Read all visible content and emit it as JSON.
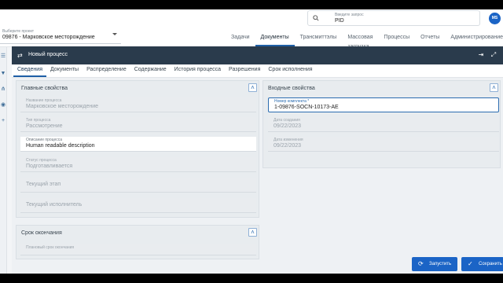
{
  "header": {
    "project_select": {
      "label": "Выберите проект",
      "value": "09876 - Марковское месторождение"
    },
    "search": {
      "label": "Введите запрос",
      "value": "PID"
    },
    "avatar": "MS"
  },
  "nav_tabs": [
    {
      "label": "Задачи"
    },
    {
      "label": "Документы"
    },
    {
      "label": "Трансмиттэлы"
    },
    {
      "label": "Массовая загрузка"
    },
    {
      "label": "Процессы"
    },
    {
      "label": "Отчеты"
    },
    {
      "label": "Администрирование"
    }
  ],
  "panel": {
    "title": "Новый процесс",
    "tabs": [
      {
        "label": "Сведения"
      },
      {
        "label": "Документы"
      },
      {
        "label": "Распределение"
      },
      {
        "label": "Содержание"
      },
      {
        "label": "История процесса"
      },
      {
        "label": "Разрешения"
      },
      {
        "label": "Срок исполнения"
      }
    ]
  },
  "main_props": {
    "title": "Главные свойства",
    "fields": [
      {
        "label": "Название процесса",
        "value": "Марковское месторождение"
      },
      {
        "label": "Тип процесса",
        "value": "Рассмотрение"
      },
      {
        "label": "Описание процесса",
        "value": "Human readable description"
      },
      {
        "label": "Статус процесса",
        "value": "Подготавливается"
      },
      {
        "label": "",
        "value": "Текущий этап"
      },
      {
        "label": "",
        "value": "Текущий исполнитель"
      }
    ]
  },
  "deadline": {
    "title": "Срок окончания",
    "field": {
      "label": "Плановый срок окончания",
      "value": ""
    }
  },
  "input_props": {
    "title": "Входные свойства",
    "fields": [
      {
        "label": "Номер комплекта *",
        "value": "1-09876-SOCN-10173-AE"
      },
      {
        "label": "Дата создания",
        "value": "09/22/2023"
      },
      {
        "label": "Дата изменения",
        "value": "09/22/2023"
      }
    ]
  },
  "buttons": {
    "launch": "Запустить",
    "save": "Сохранить"
  },
  "colors": {
    "accent": "#1b64c6",
    "header": "#2a3b4c"
  }
}
